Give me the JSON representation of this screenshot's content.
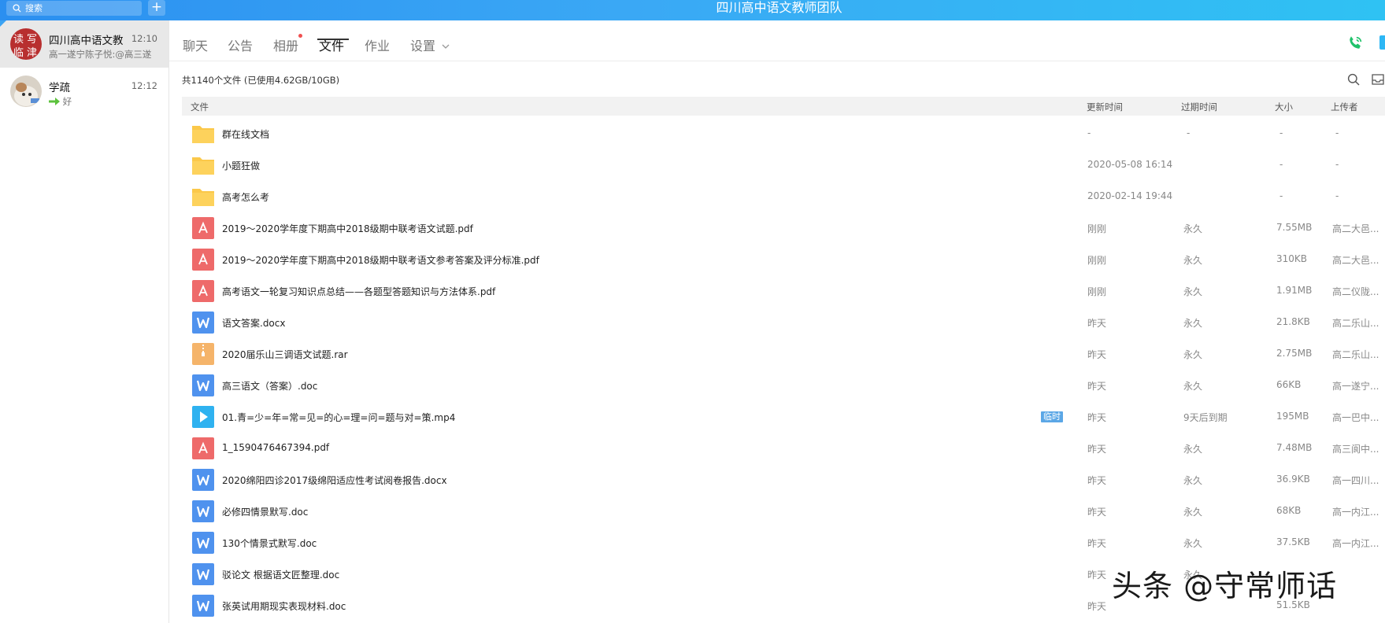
{
  "topbar": {
    "search_placeholder": "搜索",
    "add_label": "+",
    "window_title": "四川高中语文教师团队",
    "gradient_colors": [
      "#2b8ff0",
      "#2fc2f3"
    ]
  },
  "sessions": [
    {
      "name": "四川高中语文教",
      "time": "12:10",
      "preview": "高一遂宁陈子悦:@高三遂",
      "avatar_icon": "calligraphy-group-avatar"
    },
    {
      "name": "学疏",
      "time": "12:12",
      "preview": "好",
      "preview_icon": "green-arrow-icon",
      "avatar_icon": "cat-avatar"
    }
  ],
  "tabs": [
    {
      "label": "聊天"
    },
    {
      "label": "公告"
    },
    {
      "label": "相册"
    },
    {
      "label": "文件",
      "active": true
    },
    {
      "label": "作业"
    },
    {
      "label": "设置"
    }
  ],
  "files": {
    "summary": "共1140个文件 (已使用4.62GB/10GB)",
    "columns": [
      "文件",
      "更新时间",
      "过期时间",
      "大小",
      "上传者"
    ],
    "rows": [
      {
        "type": "folder",
        "name": "群在线文档",
        "updated": "-",
        "expires": "-",
        "size": "-",
        "uploader": "-"
      },
      {
        "type": "folder",
        "name": "小题狂做",
        "updated": "2020-05-08 16:14",
        "expires": "",
        "size": "-",
        "uploader": "-"
      },
      {
        "type": "folder",
        "name": "高考怎么考",
        "updated": "2020-02-14 19:44",
        "expires": "",
        "size": "-",
        "uploader": "-"
      },
      {
        "type": "pdf",
        "name": "2019～2020学年度下期高中2018级期中联考语文试题.pdf",
        "updated": "刚刚",
        "expires": "永久",
        "size": "7.55MB",
        "uploader": "高二大邑..."
      },
      {
        "type": "pdf",
        "name": "2019～2020学年度下期高中2018级期中联考语文参考答案及评分标准.pdf",
        "updated": "刚刚",
        "expires": "永久",
        "size": "310KB",
        "uploader": "高二大邑..."
      },
      {
        "type": "pdf",
        "name": "高考语文一轮复习知识点总结——各题型答题知识与方法体系.pdf",
        "updated": "刚刚",
        "expires": "永久",
        "size": "1.91MB",
        "uploader": "高二仪陇..."
      },
      {
        "type": "word",
        "name": "语文答案.docx",
        "updated": "昨天",
        "expires": "永久",
        "size": "21.8KB",
        "uploader": "高二乐山..."
      },
      {
        "type": "rar",
        "name": "2020届乐山三调语文试题.rar",
        "updated": "昨天",
        "expires": "永久",
        "size": "2.75MB",
        "uploader": "高二乐山..."
      },
      {
        "type": "word",
        "name": "高三语文（答案）.doc",
        "updated": "昨天",
        "expires": "永久",
        "size": "66KB",
        "uploader": "高一遂宁..."
      },
      {
        "type": "video",
        "name": "01.青=少=年=常=见=的心=理=问=题与对=策.mp4",
        "badge": "临时",
        "updated": "昨天",
        "expires": "9天后到期",
        "size": "195MB",
        "uploader": "高一巴中..."
      },
      {
        "type": "pdf",
        "name": "1_1590476467394.pdf",
        "updated": "昨天",
        "expires": "永久",
        "size": "7.48MB",
        "uploader": "高三阆中..."
      },
      {
        "type": "word",
        "name": "2020绵阳四诊2017级绵阳适应性考试阅卷报告.docx",
        "updated": "昨天",
        "expires": "永久",
        "size": "36.9KB",
        "uploader": "高一四川..."
      },
      {
        "type": "word",
        "name": "必修四情景默写.doc",
        "updated": "昨天",
        "expires": "永久",
        "size": "68KB",
        "uploader": "高一内江..."
      },
      {
        "type": "word",
        "name": "130个情景式默写.doc",
        "updated": "昨天",
        "expires": "永久",
        "size": "37.5KB",
        "uploader": "高一内江..."
      },
      {
        "type": "word",
        "name": "驳论文  根据语文匠整理.doc",
        "updated": "昨天",
        "expires": "永久",
        "size": "",
        "uploader": ""
      },
      {
        "type": "word",
        "name": "张英试用期现实表现材料.doc",
        "updated": "昨天",
        "expires": "",
        "size": "51.5KB",
        "uploader": ""
      }
    ]
  },
  "watermark": "头条 @守常师话",
  "colors": {
    "folder": "#fbc84a",
    "pdf": "#ee6a6a",
    "word": "#4f92ee",
    "rar": "#f5b46a",
    "video": "#2fb2f0",
    "badge": "#5ba7e6",
    "phone": "#1fc26a"
  }
}
